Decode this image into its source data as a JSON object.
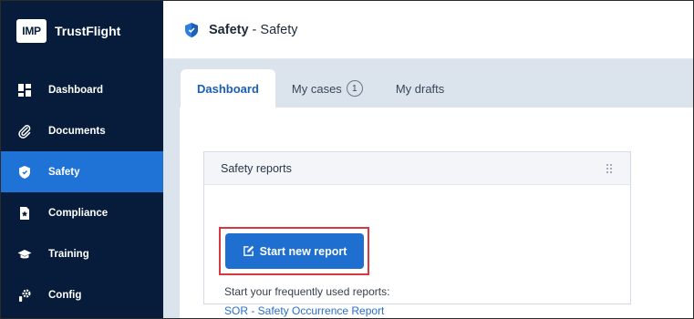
{
  "brand": {
    "logo_text": "IMP",
    "name": "TrustFlight"
  },
  "sidebar": {
    "items": [
      {
        "label": "Dashboard",
        "icon": "dashboard-icon"
      },
      {
        "label": "Documents",
        "icon": "paperclip-icon"
      },
      {
        "label": "Safety",
        "icon": "shield-icon",
        "active": true
      },
      {
        "label": "Compliance",
        "icon": "star-document-icon"
      },
      {
        "label": "Training",
        "icon": "graduation-cap-icon"
      },
      {
        "label": "Config",
        "icon": "gear-icon"
      }
    ]
  },
  "header": {
    "title_strong": "Safety",
    "title_rest": " - Safety",
    "icon": "shield-icon"
  },
  "tabs": [
    {
      "label": "Dashboard",
      "active": true
    },
    {
      "label": "My cases",
      "badge": "1"
    },
    {
      "label": "My drafts"
    }
  ],
  "card": {
    "title": "Safety reports",
    "start_button_label": "Start new report",
    "frequent_label": "Start your frequently used reports:",
    "frequent_link": "SOR - Safety Occurrence Report"
  },
  "colors": {
    "sidebar_bg": "#061c3a",
    "accent": "#1f73d6",
    "highlight": "#d9383f"
  }
}
